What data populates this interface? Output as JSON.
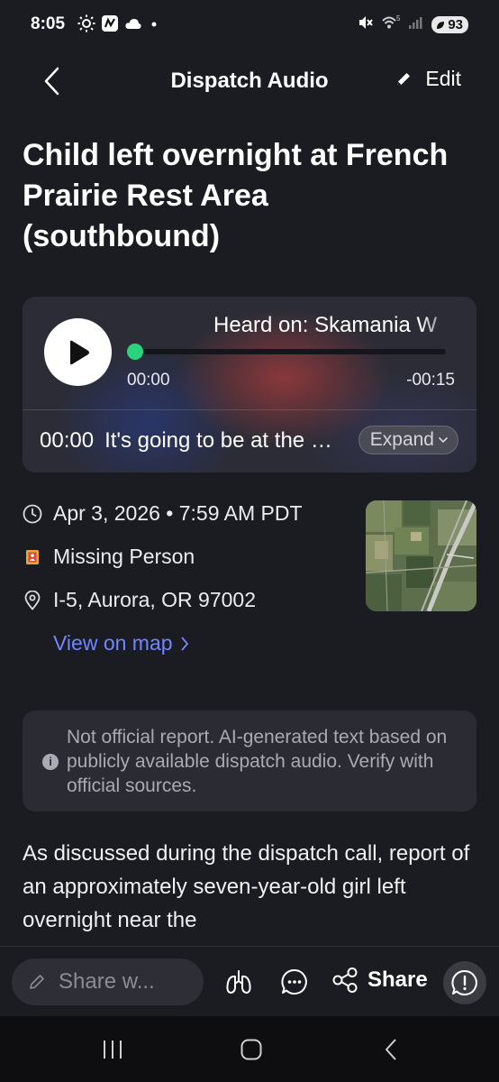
{
  "status_bar": {
    "time": "8:05",
    "battery": "93",
    "signal_label": "5"
  },
  "header": {
    "title": "Dispatch Audio",
    "edit_label": "Edit"
  },
  "incident": {
    "title": "Child left overnight at French Prairie Rest Area (southbound)"
  },
  "audio": {
    "heard_on": "Heard on: Skamania W",
    "time_start": "00:00",
    "time_remaining": "-00:15",
    "progress": 0,
    "transcript_time": "00:00",
    "transcript_text": "It's going to be at the French Prairie Rest Area",
    "expand_label": "Expand"
  },
  "details": {
    "datetime": "Apr 3, 2026 • 7:59 AM PDT",
    "category": "Missing Person",
    "location": "I-5, Aurora, OR 97002",
    "map_link": "View on map"
  },
  "disclaimer": {
    "text": "Not official report. AI-generated text based on publicly available dispatch audio. Verify with official sources."
  },
  "body": {
    "text": "As discussed during the dispatch call, report of an approximately seven-year-old girl left overnight near the"
  },
  "actions": {
    "share_placeholder": "Share w...",
    "share_label": "Share"
  },
  "colors": {
    "background": "#1b1c21",
    "accent_green": "#2ad47d",
    "link_blue": "#6f86ff",
    "card_bg": "#2b2c33"
  }
}
